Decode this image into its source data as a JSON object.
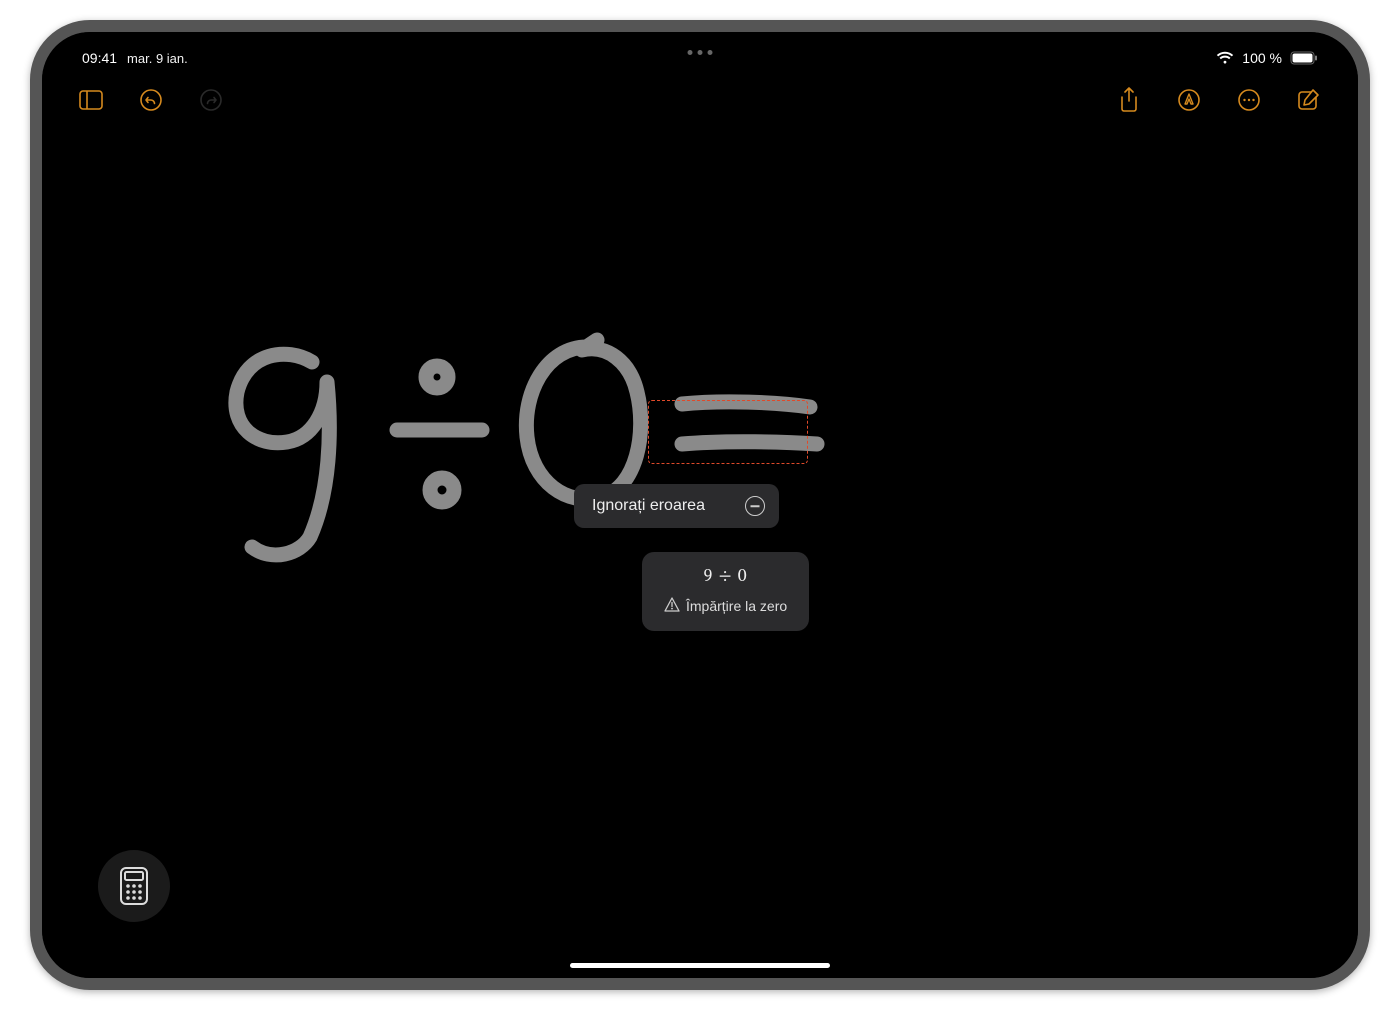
{
  "status": {
    "time": "09:41",
    "date": "mar. 9 ian.",
    "battery_pct": "100 %"
  },
  "popup": {
    "ignore_label": "Ignorați eroarea",
    "expression": "9 ÷ 0",
    "error_msg": "Împărțire la zero"
  },
  "icons": {
    "sidebar": "sidebar-icon",
    "undo": "undo-icon",
    "redo": "redo-icon",
    "share": "share-icon",
    "markup": "markup-icon",
    "more": "more-icon",
    "compose": "compose-icon",
    "wifi": "wifi-icon",
    "battery": "battery-icon",
    "warning": "warning-icon",
    "minus": "minus-circle-icon",
    "calculator": "calculator-icon"
  }
}
